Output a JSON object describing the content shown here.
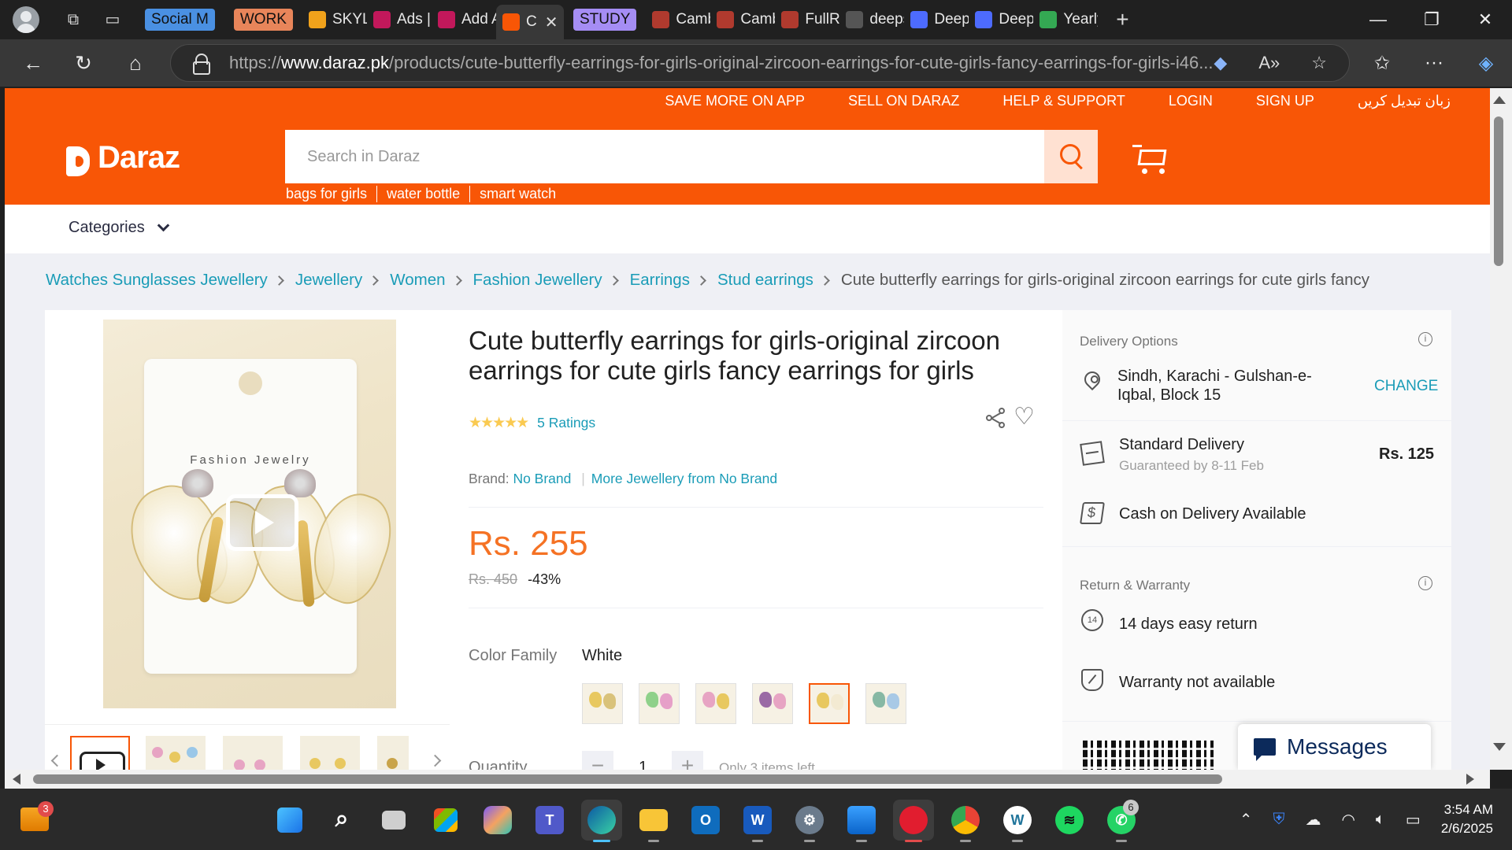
{
  "browser": {
    "tabs": [
      {
        "label": "Social M",
        "kind": "group",
        "color": "#4a90e2"
      },
      {
        "label": "WORK",
        "kind": "group",
        "color": "#e8855a"
      },
      {
        "label": "SKYLIN",
        "kind": "tab",
        "fav_color": "#f1a21b"
      },
      {
        "label": "Ads | T",
        "kind": "tab",
        "fav_color": "#c2185b"
      },
      {
        "label": "Add A",
        "kind": "tab",
        "fav_color": "#c2185b"
      },
      {
        "label": "C",
        "kind": "active",
        "fav_color": "#f85606"
      },
      {
        "label": "STUDY",
        "kind": "group",
        "color": "#a58df4"
      },
      {
        "label": "Cambr",
        "kind": "tab",
        "fav_color": "#b03a2e"
      },
      {
        "label": "Cambr",
        "kind": "tab",
        "fav_color": "#b03a2e"
      },
      {
        "label": "FullRe",
        "kind": "tab",
        "fav_color": "#b03a2e"
      },
      {
        "label": "deeps",
        "kind": "tab",
        "fav_color": "#555"
      },
      {
        "label": "DeepS",
        "kind": "tab",
        "fav_color": "#4d6bfe"
      },
      {
        "label": "DeepS",
        "kind": "tab",
        "fav_color": "#4d6bfe"
      },
      {
        "label": "Yearly",
        "kind": "tab",
        "fav_color": "#34a853"
      }
    ],
    "url_prefix": "https://",
    "url_domain": "www.daraz.pk",
    "url_path": "/products/cute-butterfly-earrings-for-girls-original-zircoon-earrings-for-cute-girls-fancy-earrings-for-girls-i46..."
  },
  "daraz": {
    "top_links": [
      "SAVE MORE ON APP",
      "SELL ON DARAZ",
      "HELP & SUPPORT",
      "LOGIN",
      "SIGN UP",
      "زبان تبدیل کریں"
    ],
    "logo_text": "Daraz",
    "search_placeholder": "Search in Daraz",
    "suggestions": [
      "bags for girls",
      "water bottle",
      "smart watch"
    ],
    "categories_label": "Categories",
    "breadcrumb": [
      "Watches Sunglasses Jewellery",
      "Jewellery",
      "Women",
      "Fashion Jewellery",
      "Earrings",
      "Stud earrings"
    ],
    "breadcrumb_current": "Cute butterfly earrings for girls-original zircoon earrings for cute girls fancy",
    "product": {
      "title": "Cute butterfly earrings for girls-original zircoon earrings for cute girls fancy earrings for girls",
      "image_card_text": "Fashion Jewelry",
      "stars": "★★★★★",
      "rating_text": "5 Ratings",
      "brand_label": "Brand:",
      "brand_value": "No Brand",
      "more_from": "More Jewellery from No Brand",
      "price": "Rs. 255",
      "old_price": "Rs. 450",
      "discount": "-43%",
      "color_family_label": "Color Family",
      "color_family_value": "White",
      "swatches": [
        {
          "c1": "#e8c860",
          "c2": "#d9c27a"
        },
        {
          "c1": "#8fd18a",
          "c2": "#e6a0c8"
        },
        {
          "c1": "#e7a4c3",
          "c2": "#e8c860"
        },
        {
          "c1": "#9a6aa5",
          "c2": "#e7a4c3"
        },
        {
          "c1": "#e8c860",
          "c2": "#f3ead2"
        },
        {
          "c1": "#87b8a4",
          "c2": "#a8c9e6"
        }
      ],
      "quantity_label": "Quantity",
      "quantity_value": "1",
      "qty_minus": "−",
      "qty_plus": "+",
      "stock_note": "Only 3 items left"
    },
    "delivery": {
      "title": "Delivery Options",
      "location": "Sindh, Karachi - Gulshan-e-Iqbal, Block 15",
      "change": "CHANGE",
      "standard": "Standard Delivery",
      "guarantee": "Guaranteed by 8-11 Feb",
      "fee": "Rs. 125",
      "cod": "Cash on Delivery Available"
    },
    "returns": {
      "title": "Return & Warranty",
      "return_text": "14 days easy return",
      "return_badge": "14",
      "warranty_text": "Warranty not available"
    },
    "messages_label": "Messages"
  },
  "taskbar": {
    "weather_badge": "3",
    "whatsapp_badge": "6",
    "time": "3:54 AM",
    "date": "2/6/2025"
  }
}
